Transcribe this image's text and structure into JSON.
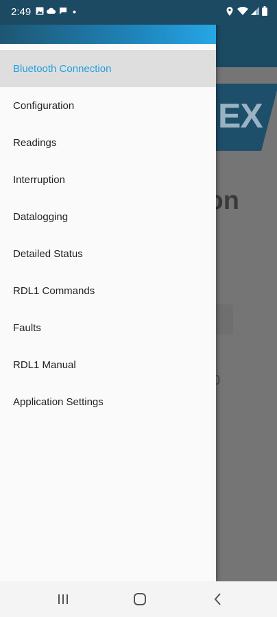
{
  "status_bar": {
    "time": "2:49",
    "left_icons": [
      "image-icon",
      "cloud-icon",
      "message-icon",
      "dot-icon"
    ],
    "right_icons": [
      "location-icon",
      "wifi-icon",
      "signal-icon",
      "battery-icon"
    ]
  },
  "background_app": {
    "logo_text": "EX",
    "heading_fragment": "ion",
    "small_fragment": "0"
  },
  "drawer": {
    "header_gradient": [
      "#1d5673",
      "#26a6e6"
    ],
    "items": [
      {
        "label": "Bluetooth Connection",
        "active": true
      },
      {
        "label": "Configuration",
        "active": false
      },
      {
        "label": "Readings",
        "active": false
      },
      {
        "label": "Interruption",
        "active": false
      },
      {
        "label": "Datalogging",
        "active": false
      },
      {
        "label": "Detailed Status",
        "active": false
      },
      {
        "label": "RDL1 Commands",
        "active": false
      },
      {
        "label": "Faults",
        "active": false
      },
      {
        "label": "RDL1 Manual",
        "active": false
      },
      {
        "label": "Application Settings",
        "active": false
      }
    ]
  },
  "nav_bar": {
    "buttons": [
      "recents-icon",
      "home-icon",
      "back-icon"
    ]
  },
  "colors": {
    "accent": "#1ea0e0",
    "active_bg": "#dedede",
    "toolbar": "#1b4a62"
  }
}
